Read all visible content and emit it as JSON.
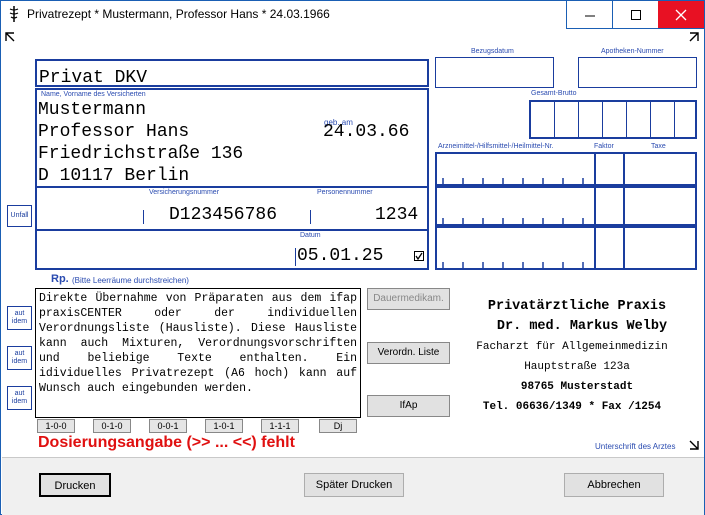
{
  "window": {
    "title": "Privatrezept * Mustermann, Professor Hans * 24.03.1966",
    "minimize_label": "minimize",
    "maximize_label": "maximize",
    "close_label": "close"
  },
  "form": {
    "insurance": "Privat DKV",
    "name_label": "Name, Vorname des Versicherten",
    "dob_label": "geb. am",
    "patient_lines": [
      "Mustermann",
      "Professor Hans",
      "Friedrichstraße 136",
      "D 10117 Berlin"
    ],
    "dob": "24.03.66",
    "insurance_no_label": "Versicherungsnummer",
    "insurance_no": "D123456786",
    "person_no_label": "Personennummer",
    "person_no": "1234",
    "date_label": "Datum",
    "date": "05.01.25",
    "date_checked": true,
    "unfall_label": "Unfall",
    "aut_idem_label_1": "aut",
    "aut_idem_label_2": "idem",
    "rp_label": "Rp.",
    "rp_hint": "(Bitte Leerräume durchstreichen)",
    "rp_text": "Direkte Übernahme von Präparaten aus dem ifap praxisCENTER oder der individuellen Verordnungsliste (Hausliste). Diese Hausliste kann auch Mixturen, Verordnungsvorschriften und beliebige Texte enthalten. Ein idividuelles Privatrezept (A6 hoch) kann auf Wunsch auch eingebunden werden.",
    "dose_buttons": [
      "1-0-0",
      "0-1-0",
      "0-0-1",
      "1-0-1",
      "1-1-1",
      "Dj"
    ],
    "dose_warning": "Dosierungsangabe (>> ... <<) fehlt",
    "side_buttons": {
      "dauermedikam": "Dauermedikam.",
      "verordn_liste": "Verordn. Liste",
      "ifap": "IfAp"
    }
  },
  "right_panel": {
    "bezugsdatum_label": "Bezugsdatum",
    "apotheken_label": "Apotheken-Nummer",
    "gesamt_label": "Gesamt-Brutto",
    "arznei_label": "Arzneimittel-/Hilfsmittel-/Heilmittel-Nr.",
    "faktor_label": "Faktor",
    "taxe_label": "Taxe",
    "signature_label": "Unterschrift des Arztes"
  },
  "practice": {
    "lines": [
      "Privatärztliche Praxis",
      "Dr. med. Markus Welby",
      "Facharzt für Allgemeinmedizin",
      "Hauptstraße 123a",
      "98765 Musterstadt",
      "Tel. 06636/1349 * Fax /1254"
    ]
  },
  "footer": {
    "print_label": "Drucken",
    "print_later_label": "Später Drucken",
    "cancel_label": "Abbrechen"
  },
  "colors": {
    "form_blue": "#1a3d9e",
    "warning_red": "#e01010",
    "close_red": "#e81123"
  }
}
